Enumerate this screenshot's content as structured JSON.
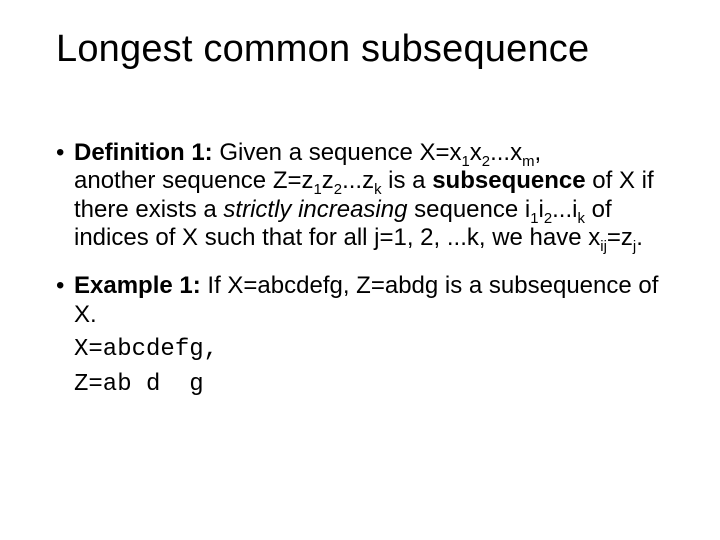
{
  "title": "Longest common subsequence",
  "defn": {
    "label": "Definition 1:",
    "pre": " Given a sequence ",
    "X_eq": "X=x",
    "s1": "1",
    "x": "x",
    "s2": "2",
    "dots": "...",
    "sm": "m",
    "comma": ",",
    "line2a": "another sequence Z=z",
    "z": "z",
    "sk": "k",
    "line2b": " is a ",
    "subseq": "subsequence",
    "line2c": " of X if there exists a ",
    "strictly": "strictly increasing",
    "line3a": " sequence i",
    "i": "i",
    "line3b": " of indices of X such that for all j=1, 2, ...k, we have x",
    "sij": "ij",
    "eqz": "=z",
    "sj": "j",
    "period": "."
  },
  "ex": {
    "label": "Example 1:",
    "text": " If X=abcdefg, Z=abdg is a subsequence of X.",
    "code1": "X=abcdefg,",
    "code2": "Z=ab d  g"
  }
}
